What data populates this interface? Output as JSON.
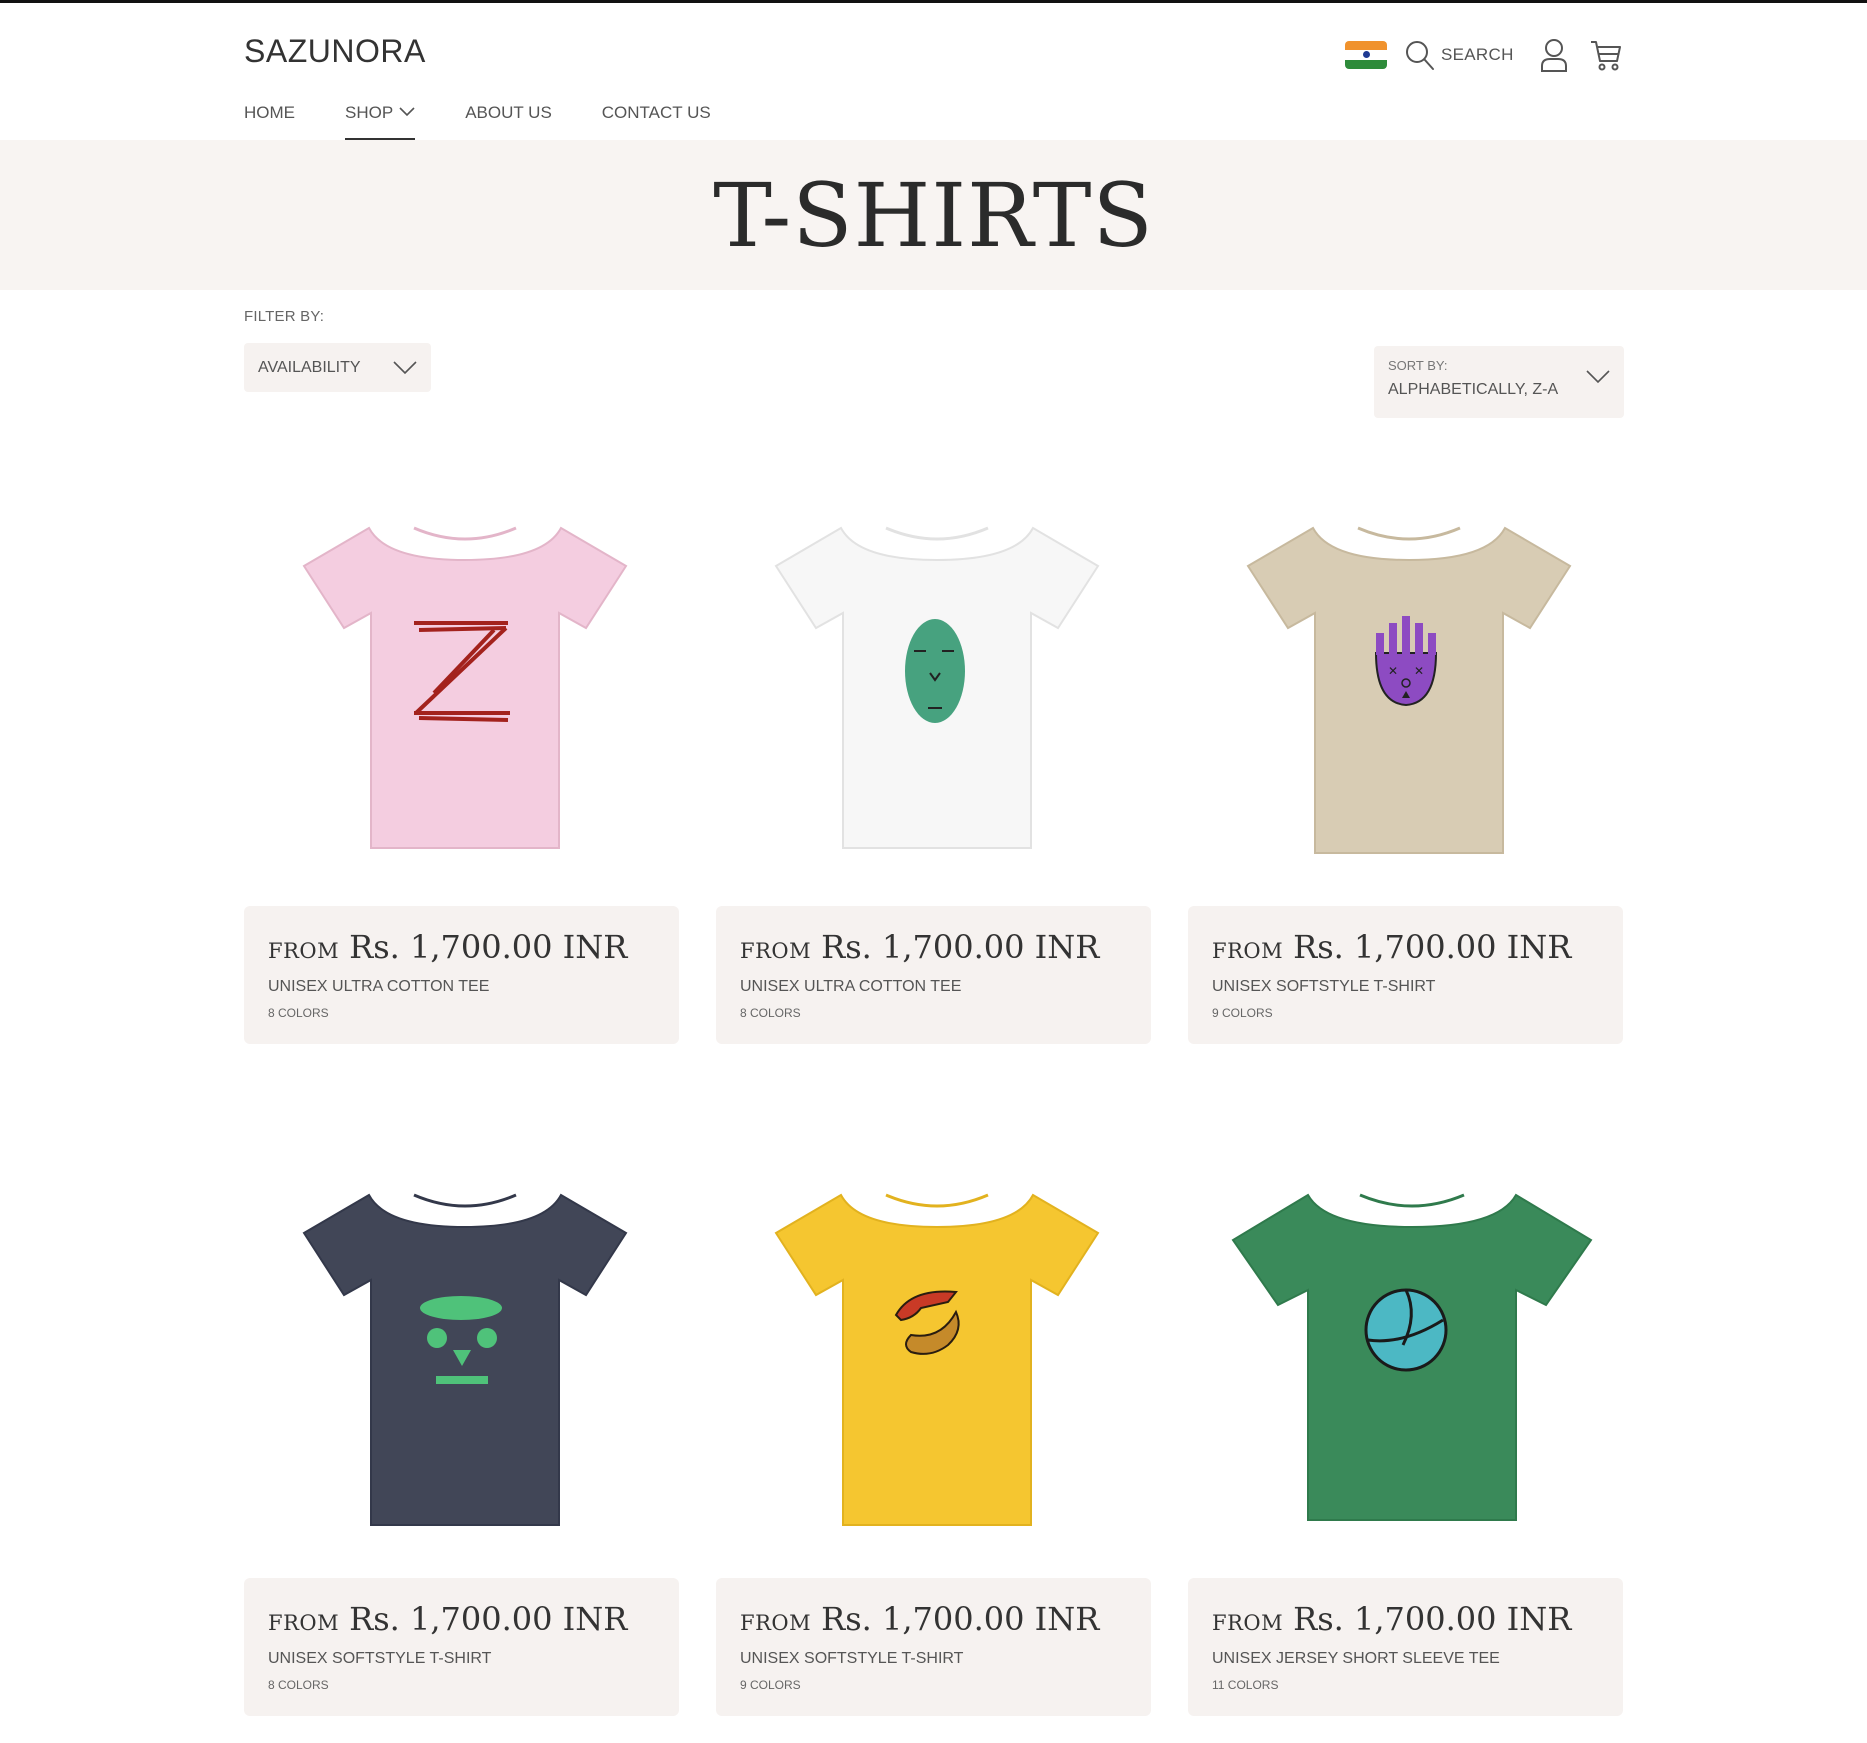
{
  "header": {
    "logo": "SAZUNORA",
    "search_label": "SEARCH",
    "nav": [
      {
        "label": "HOME"
      },
      {
        "label": "SHOP"
      },
      {
        "label": "ABOUT US"
      },
      {
        "label": "CONTACT US"
      }
    ],
    "active_nav": "SHOP",
    "icons": [
      "india-flag-icon",
      "search-icon",
      "account-icon",
      "cart-icon"
    ]
  },
  "banner": {
    "title": "T-SHIRTS"
  },
  "filters": {
    "filter_label": "FILTER BY:",
    "availability_label": "AVAILABILITY",
    "sort_label": "SORT BY:",
    "sort_value": "ALPHABETICALLY, Z-A"
  },
  "products": [
    {
      "from": "FROM",
      "price": "Rs. 1,700.00 INR",
      "name": "UNISEX ULTRA COTTON TEE",
      "colors": "8 COLORS",
      "shirt_color": "#f4cde0",
      "design": "z-letter"
    },
    {
      "from": "FROM",
      "price": "Rs. 1,700.00 INR",
      "name": "UNISEX ULTRA COTTON TEE",
      "colors": "8 COLORS",
      "shirt_color": "#f7f7f7",
      "design": "green-oval-face"
    },
    {
      "from": "FROM",
      "price": "Rs. 1,700.00 INR",
      "name": "UNISEX SOFTSTYLE T-SHIRT",
      "colors": "9 COLORS",
      "shirt_color": "#d8ccb4",
      "design": "purple-mask"
    },
    {
      "from": "FROM",
      "price": "Rs. 1,700.00 INR",
      "name": "UNISEX SOFTSTYLE T-SHIRT",
      "colors": "8 COLORS",
      "shirt_color": "#414657",
      "design": "green-robot-face"
    },
    {
      "from": "FROM",
      "price": "Rs. 1,700.00 INR",
      "name": "UNISEX SOFTSTYLE T-SHIRT",
      "colors": "9 COLORS",
      "shirt_color": "#f5c630",
      "design": "hands"
    },
    {
      "from": "FROM",
      "price": "Rs. 1,700.00 INR",
      "name": "UNISEX JERSEY SHORT SLEEVE TEE",
      "colors": "11 COLORS",
      "shirt_color": "#3a8a5a",
      "design": "teal-ball"
    }
  ],
  "colors": {
    "banner_bg": "#f8f4f2",
    "card_bg": "#f6f2f0",
    "text": "#333333"
  }
}
